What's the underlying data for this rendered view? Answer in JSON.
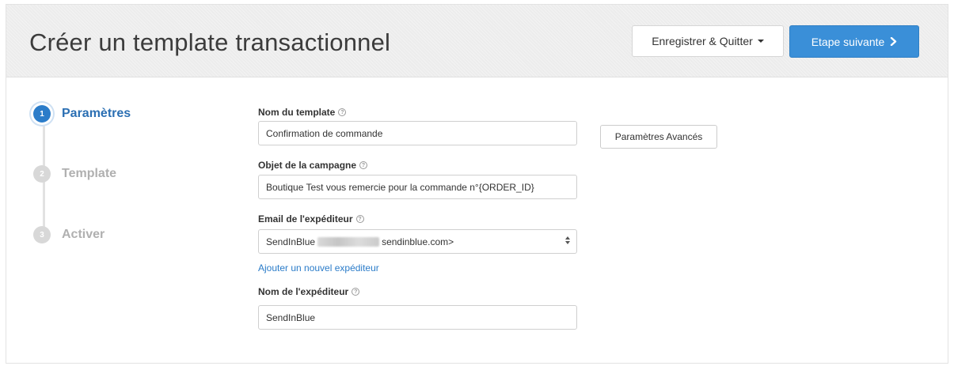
{
  "header": {
    "title": "Créer un template transactionnel",
    "save_quit_label": "Enregistrer & Quitter",
    "next_step_label": "Etape suivante"
  },
  "stepper": {
    "steps": [
      {
        "number": "1",
        "label": "Paramètres",
        "state": "active"
      },
      {
        "number": "2",
        "label": "Template",
        "state": "inactive"
      },
      {
        "number": "3",
        "label": "Activer",
        "state": "inactive"
      }
    ]
  },
  "form": {
    "template_name": {
      "label": "Nom du template",
      "value": "Confirmation de commande"
    },
    "advanced_settings_label": "Paramètres Avancés",
    "campaign_subject": {
      "label": "Objet de la campagne",
      "value": "Boutique Test  vous remercie pour la commande n°{ORDER_ID}"
    },
    "sender_email": {
      "label": "Email de l'expéditeur",
      "value_prefix": "SendInBlue",
      "value_suffix": "sendinblue.com>"
    },
    "add_sender_link": "Ajouter un nouvel expéditeur",
    "sender_name": {
      "label": "Nom de l'expéditeur",
      "value": "SendInBlue"
    }
  },
  "colors": {
    "primary": "#3a8fd8",
    "active_step": "#2b7cc9",
    "link": "#2b7cc9"
  }
}
